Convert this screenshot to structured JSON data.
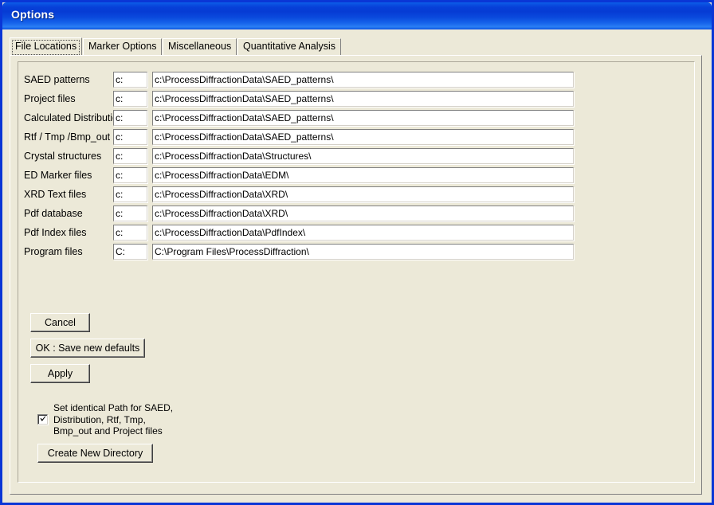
{
  "window": {
    "title": "Options",
    "accent_color": "#0a36d6",
    "face_color": "#ece9d8"
  },
  "tabs": [
    {
      "label": "File Locations",
      "selected": true
    },
    {
      "label": "Marker Options",
      "selected": false
    },
    {
      "label": "Miscellaneous",
      "selected": false
    },
    {
      "label": "Quantitative Analysis",
      "selected": false
    }
  ],
  "file_locations": {
    "rows": [
      {
        "label": "SAED patterns",
        "drive": "c:",
        "path": "c:\\ProcessDiffractionData\\SAED_patterns\\"
      },
      {
        "label": "Project files",
        "drive": "c:",
        "path": "c:\\ProcessDiffractionData\\SAED_patterns\\"
      },
      {
        "label": "Calculated Distributions",
        "drive": "c:",
        "path": "c:\\ProcessDiffractionData\\SAED_patterns\\"
      },
      {
        "label": "Rtf / Tmp /Bmp_out",
        "drive": "c:",
        "path": "c:\\ProcessDiffractionData\\SAED_patterns\\"
      },
      {
        "label": "Crystal structures",
        "drive": "c:",
        "path": "c:\\ProcessDiffractionData\\Structures\\"
      },
      {
        "label": "ED Marker files",
        "drive": "c:",
        "path": "c:\\ProcessDiffractionData\\EDM\\"
      },
      {
        "label": "XRD Text files",
        "drive": "c:",
        "path": "c:\\ProcessDiffractionData\\XRD\\"
      },
      {
        "label": "Pdf database",
        "drive": "c:",
        "path": "c:\\ProcessDiffractionData\\XRD\\"
      },
      {
        "label": "Pdf Index files",
        "drive": "c:",
        "path": "c:\\ProcessDiffractionData\\PdfIndex\\"
      },
      {
        "label": "Program files",
        "drive": "C:",
        "path": "C:\\Program Files\\ProcessDiffraction\\"
      }
    ]
  },
  "buttons": {
    "cancel": "Cancel",
    "ok_save": "OK : Save new defaults",
    "apply": "Apply",
    "create_dir": "Create New Directory"
  },
  "identical_path_option": {
    "checked": true,
    "line1": "Set identical Path for SAED,",
    "line2": "Distribution, Rtf, Tmp,",
    "line3": "Bmp_out and Project files"
  }
}
